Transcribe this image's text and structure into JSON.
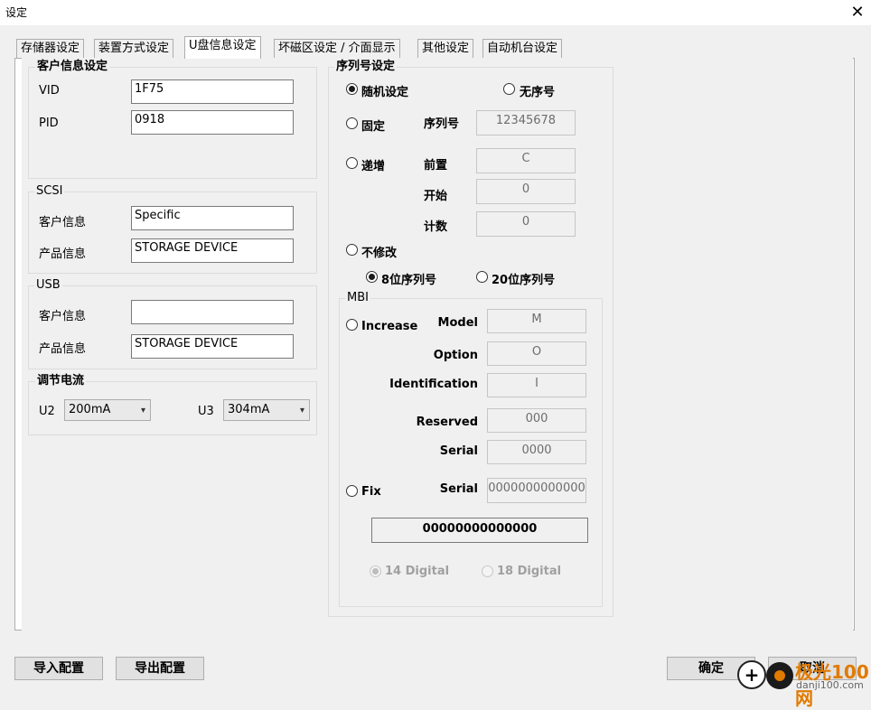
{
  "window": {
    "title": "设定",
    "close_icon": "close-icon"
  },
  "tabs": [
    "存储器设定",
    "装置方式设定",
    "U盘信息设定",
    "坏磁区设定 / 介面显示",
    "其他设定",
    "自动机台设定"
  ],
  "customer_info": {
    "title": "客户信息设定",
    "vid_label": "VID",
    "vid_value": "1F75",
    "pid_label": "PID",
    "pid_value": "0918"
  },
  "scsi": {
    "title": "SCSI",
    "customer_label": "客户信息",
    "customer_value": "Specific",
    "product_label": "产品信息",
    "product_value": "STORAGE DEVICE"
  },
  "usb": {
    "title": "USB",
    "customer_label": "客户信息",
    "customer_value": "",
    "product_label": "产品信息",
    "product_value": "STORAGE DEVICE"
  },
  "current": {
    "title": "调节电流",
    "u2_label": "U2",
    "u2_value": "200mA",
    "u3_label": "U3",
    "u3_value": "304mA"
  },
  "serial": {
    "title": "序列号设定",
    "random_label": "随机设定",
    "none_label": "无序号",
    "fixed_label": "固定",
    "serial_no_label": "序列号",
    "serial_no_value": "12345678",
    "increment_label": "递增",
    "prefix_label": "前置",
    "prefix_value": "C",
    "start_label": "开始",
    "start_value": "0",
    "count_label": "计数",
    "count_value": "0",
    "nomodify_label": "不修改",
    "len8_label": "8位序列号",
    "len20_label": "20位序列号"
  },
  "mbi": {
    "title": "MBI",
    "increase_label": "Increase",
    "model_label": "Model",
    "model_value": "M",
    "option_label": "Option",
    "option_value": "O",
    "identification_label": "Identification",
    "identification_value": "I",
    "reserved_label": "Reserved",
    "reserved_value": "000",
    "serial_label": "Serial",
    "serial_value": "0000",
    "fix_label": "Fix",
    "fix_serial_label": "Serial",
    "fix_serial_value": "0000000000000",
    "result_value": "00000000000000",
    "digit14_label": "14 Digital",
    "digit18_label": "18 Digital"
  },
  "buttons": {
    "import": "导入配置",
    "export": "导出配置",
    "ok": "确定",
    "cancel": "取消"
  },
  "watermark": {
    "brand": "极光100网",
    "url": "danji100.com"
  }
}
